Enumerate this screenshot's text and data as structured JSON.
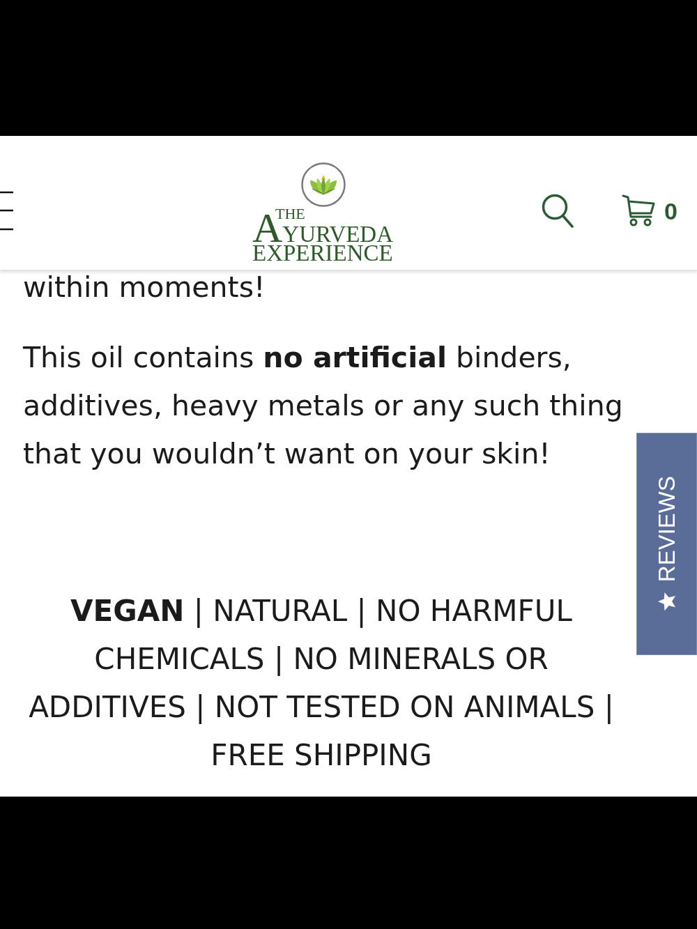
{
  "header": {
    "logo": {
      "small_word": "THE",
      "main_word": "AYURVEDA",
      "bottom_word": "EXPERIENCE"
    },
    "cart_count": "0"
  },
  "content": {
    "paragraphs": [
      "within moments!",
      "This oil contains **no artificial** binders, additives, heavy metals or any such thing that you wouldn’t want on your skin!"
    ],
    "features": "**VEGAN** | NATURAL | NO HARMFUL CHEMICALS | NO MINERALS OR ADDITIVES | NOT TESTED ON ANIMALS | FREE SHIPPING"
  },
  "reviews_tab": {
    "label": "REVIEWS"
  }
}
